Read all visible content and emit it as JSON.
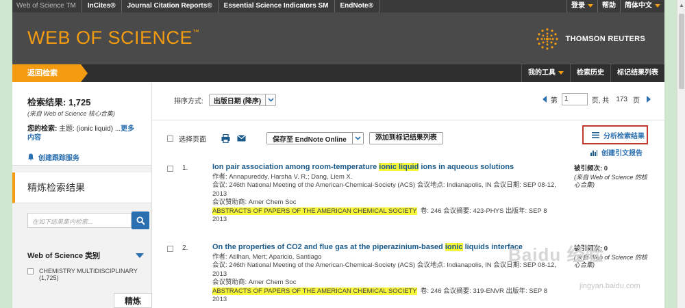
{
  "topbar": {
    "links": [
      "Web of Science TM",
      "InCites®",
      "Journal Citation Reports®",
      "Essential Science Indicators SM",
      "EndNote®"
    ],
    "login": "登录",
    "help": "帮助",
    "language": "简体中文"
  },
  "header": {
    "logo": "WEB OF SCIENCE",
    "logo_tm": "™",
    "brand": "THOMSON REUTERS"
  },
  "nav": {
    "back": "返回检索",
    "my_tools": "我的工具",
    "history": "检索历史",
    "marked_list": "标记结果列表"
  },
  "sidebar": {
    "results_label": "检索结果: 1,725",
    "results_source": "(来自 Web of Science 核心合集)",
    "your_search_label": "您的检索:",
    "query": "主题: (ionic liquid) ...",
    "more": "更多",
    "more2": "内容",
    "alert": "创建跟踪服务",
    "refine_title": "精炼检索结果",
    "search_placeholder": "在如下结果集内检索...",
    "category_title": "Web of Science 类别",
    "category_item": "CHEMISTRY MULTIDISCIPLINARY",
    "category_count": "(1,725)",
    "refine_button": "精炼"
  },
  "toolbar": {
    "sort_label": "排序方式:",
    "sort_value": "出版日期 (降序)",
    "page_prefix": "第",
    "page_value": "1",
    "page_suffix": "页, 共",
    "total_pages": "173",
    "page_unit": "页",
    "select_page": "选择页面",
    "save_to": "保存至 EndNote Online",
    "add_marked": "添加到标记结果列表",
    "analyze": "分析检索结果",
    "citation_report": "创建引文报告"
  },
  "records": [
    {
      "num": "1.",
      "title_pre": "Ion pair association among room-temperature ",
      "title_hl": "ionic liquid",
      "title_post": " ions in aqueous solutions",
      "authors": "作者: Annapureddy, Harsha V. R.; Dang, Liem X.",
      "meeting1": "会议: 246th National Meeting of the American-Chemical-Society (ACS) 会议地点: Indianapolis, IN 会议日期: SEP 08-12,",
      "meeting2": "2013",
      "sponsor": "会议赞助商: Amer Chem Soc",
      "journal": "ABSTRACTS OF PAPERS OF THE AMERICAN CHEMICAL SOCIETY",
      "journal_info": "卷: 246   会议摘要: 423-PHYS   出版年: SEP 8",
      "year": "2013",
      "cited": "被引频次: 0",
      "cited_note": "(来自 Web of Science 的核心合集)"
    },
    {
      "num": "2.",
      "title_pre": "On the properties of CO2 and flue gas at the piperazinium-based ",
      "title_hl": "ionic",
      "title_post": " liquids interface",
      "authors": "作者: Atilhan, Mert; Aparicio, Santiago",
      "meeting1": "会议: 246th National Meeting of the American-Chemical-Society (ACS) 会议地点: Indianapolis, IN 会议日期: SEP 08-12,",
      "meeting2": "2013",
      "sponsor": "会议赞助商: Amer Chem Soc",
      "journal": "ABSTRACTS OF PAPERS OF THE AMERICAN CHEMICAL SOCIETY",
      "journal_info": "卷: 246   会议摘要: 319-ENVR   出版年: SEP 8",
      "year": "2013",
      "cited": "被引频次: 0",
      "cited_note": "(来自 Web of Science 的核心合集)"
    }
  ],
  "watermark": {
    "text": "Baidu 经验",
    "url": "jingyan.baidu.com"
  }
}
